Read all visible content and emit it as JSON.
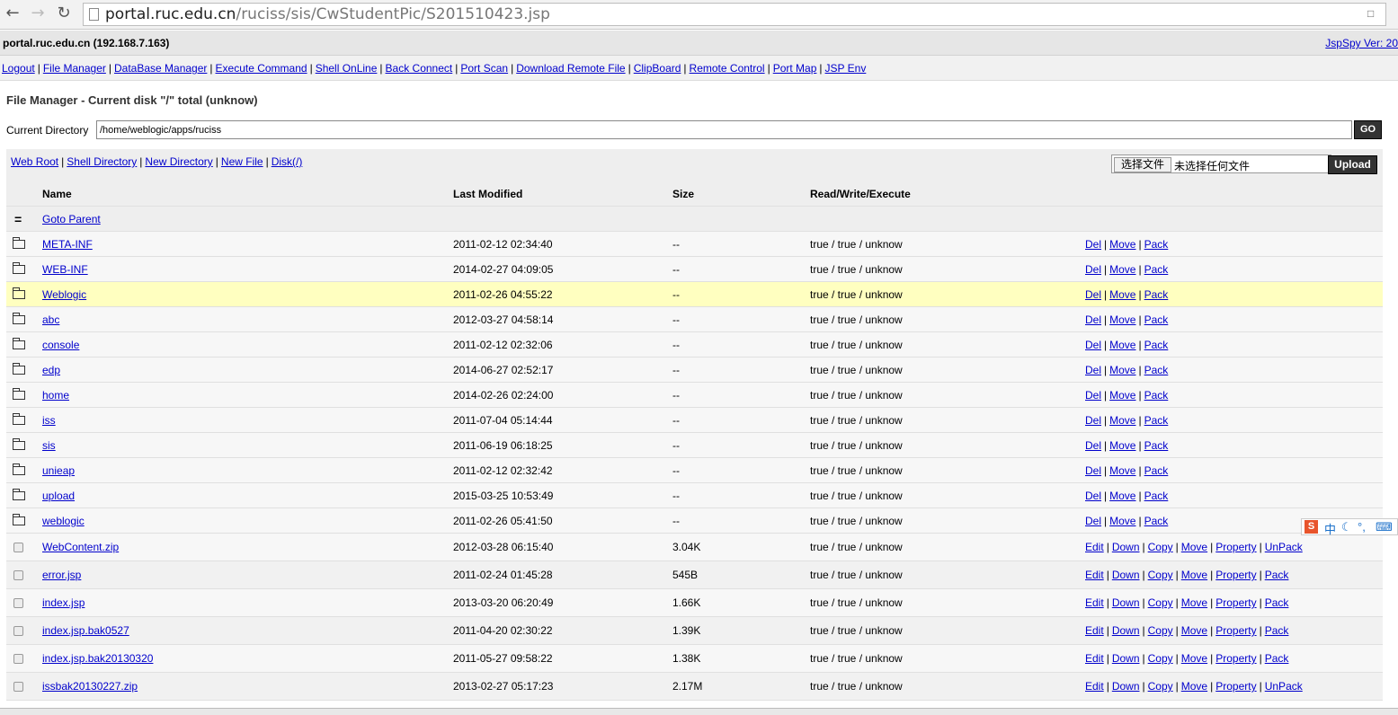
{
  "browser": {
    "url_host": "portal.ruc.edu.cn",
    "url_path": "/ruciss/sis/CwStudentPic/S201510423.jsp"
  },
  "header": {
    "host": "portal.ruc.edu.cn (192.168.7.163)",
    "version": "JspSpy Ver: 20"
  },
  "menu": [
    "Logout",
    "File Manager",
    "DataBase Manager",
    "Execute Command",
    "Shell OnLine",
    "Back Connect",
    "Port Scan",
    "Download Remote File",
    "ClipBoard",
    "Remote Control",
    "Port Map",
    "JSP Env"
  ],
  "title": "File Manager - Current disk \"/\" total (unknow)",
  "current_directory": {
    "label": "Current Directory",
    "value": "/home/weblogic/apps/ruciss",
    "go": "GO"
  },
  "toolbar": {
    "links": [
      "Web Root",
      "Shell Directory",
      "New Directory",
      "New File",
      "Disk(/)"
    ],
    "choose_file": "选择文件",
    "no_file": "未选择任何文件",
    "upload": "Upload"
  },
  "table": {
    "headers": [
      "Name",
      "Last Modified",
      "Size",
      "Read/Write/Execute"
    ],
    "parent": "Goto Parent",
    "dirs": [
      {
        "name": "META-INF",
        "modified": "2011-02-12 02:34:40",
        "size": "--",
        "rwe": "true / true / unknow"
      },
      {
        "name": "WEB-INF",
        "modified": "2014-02-27 04:09:05",
        "size": "--",
        "rwe": "true / true / unknow"
      },
      {
        "name": "Weblogic",
        "modified": "2011-02-26 04:55:22",
        "size": "--",
        "rwe": "true / true / unknow",
        "highlight": true
      },
      {
        "name": "abc",
        "modified": "2012-03-27 04:58:14",
        "size": "--",
        "rwe": "true / true / unknow"
      },
      {
        "name": "console",
        "modified": "2011-02-12 02:32:06",
        "size": "--",
        "rwe": "true / true / unknow"
      },
      {
        "name": "edp",
        "modified": "2014-06-27 02:52:17",
        "size": "--",
        "rwe": "true / true / unknow"
      },
      {
        "name": "home",
        "modified": "2014-02-26 02:24:00",
        "size": "--",
        "rwe": "true / true / unknow"
      },
      {
        "name": "iss",
        "modified": "2011-07-04 05:14:44",
        "size": "--",
        "rwe": "true / true / unknow"
      },
      {
        "name": "sis",
        "modified": "2011-06-19 06:18:25",
        "size": "--",
        "rwe": "true / true / unknow"
      },
      {
        "name": "unieap",
        "modified": "2011-02-12 02:32:42",
        "size": "--",
        "rwe": "true / true / unknow"
      },
      {
        "name": "upload",
        "modified": "2015-03-25 10:53:49",
        "size": "--",
        "rwe": "true / true / unknow"
      },
      {
        "name": "weblogic",
        "modified": "2011-02-26 05:41:50",
        "size": "--",
        "rwe": "true / true / unknow"
      }
    ],
    "dir_ops": [
      "Del",
      "Move",
      "Pack"
    ],
    "files": [
      {
        "name": "WebContent.zip",
        "modified": "2012-03-28 06:15:40",
        "size": "3.04K",
        "rwe": "true / true / unknow",
        "last_op": "UnPack"
      },
      {
        "name": "error.jsp",
        "modified": "2011-02-24 01:45:28",
        "size": "545B",
        "rwe": "true / true / unknow",
        "last_op": "Pack"
      },
      {
        "name": "index.jsp",
        "modified": "2013-03-20 06:20:49",
        "size": "1.66K",
        "rwe": "true / true / unknow",
        "last_op": "Pack"
      },
      {
        "name": "index.jsp.bak0527",
        "modified": "2011-04-20 02:30:22",
        "size": "1.39K",
        "rwe": "true / true / unknow",
        "last_op": "Pack"
      },
      {
        "name": "index.jsp.bak20130320",
        "modified": "2011-05-27 09:58:22",
        "size": "1.38K",
        "rwe": "true / true / unknow",
        "last_op": "Pack"
      },
      {
        "name": "issbak20130227.zip",
        "modified": "2013-02-27 05:17:23",
        "size": "2.17M",
        "rwe": "true / true / unknow",
        "last_op": "UnPack"
      }
    ],
    "file_ops": [
      "Edit",
      "Down",
      "Copy",
      "Move",
      "Property"
    ]
  },
  "ime": {
    "lang": "中"
  },
  "icons": [
    "back-arrow-icon",
    "forward-arrow-icon",
    "reload-icon",
    "page-icon",
    "translate-icon",
    "folder-icon",
    "checkbox-icon",
    "parent-icon"
  ]
}
